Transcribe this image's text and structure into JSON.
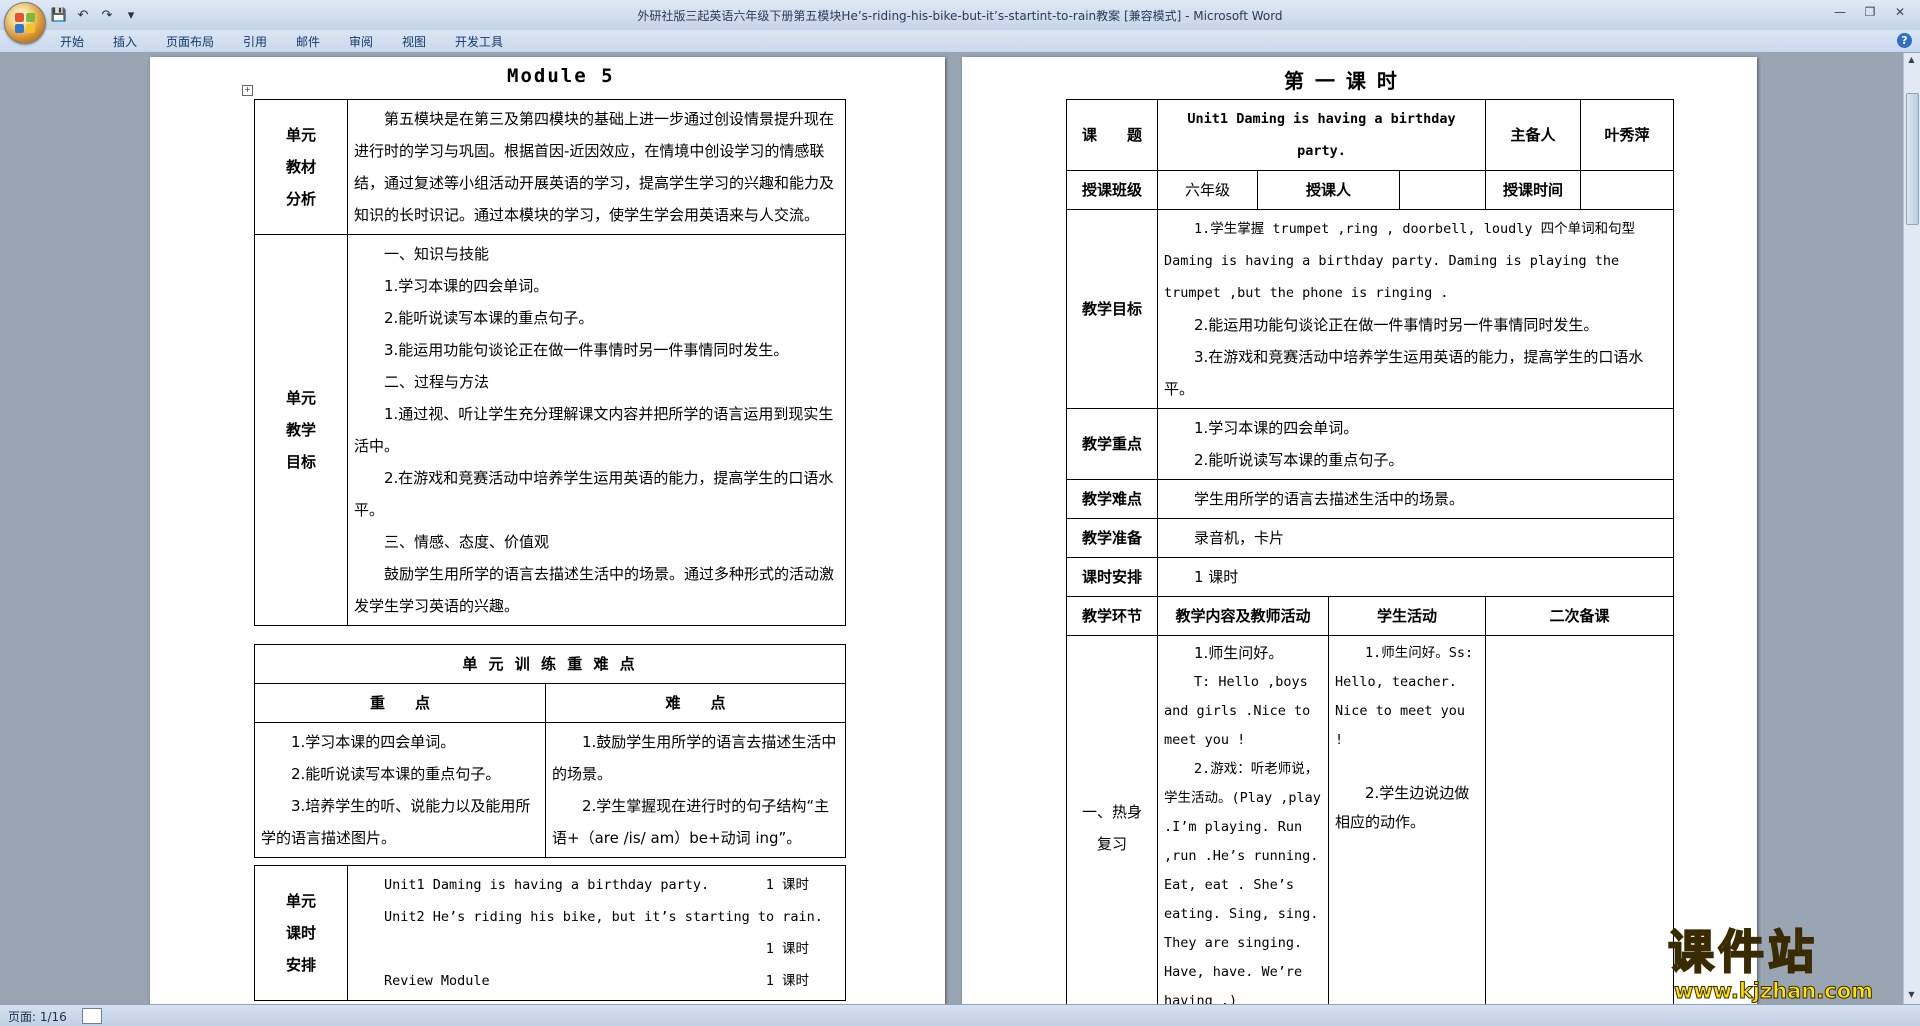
{
  "window": {
    "title": "外研社版三起英语六年级下册第五模块He’s-riding-his-bike-but-it’s-startint-to-rain教案 [兼容模式] - Microsoft Word",
    "controls": [
      "—",
      "❐",
      "✕"
    ]
  },
  "qat": {
    "save": "💾",
    "undo": "↶",
    "redo": "↷",
    "more": "▾"
  },
  "ribbon": {
    "tabs": [
      "开始",
      "插入",
      "页面布局",
      "引用",
      "邮件",
      "审阅",
      "视图",
      "开发工具"
    ],
    "help": "?"
  },
  "status": {
    "page": "页面: 1/16"
  },
  "watermark": {
    "name": "课件站",
    "url": "www.kjzhan.com"
  },
  "left_page": {
    "title": "Module 5",
    "analysis": {
      "label": [
        "单元",
        "教材",
        "分析"
      ],
      "text": "第五模块是在第三及第四模块的基础上进一步通过创设情景提升现在进行时的学习与巩固。根据首因-近因效应，在情境中创设学习的情感联结，通过复述等小组活动开展英语的学习，提高学生学习的兴趣和能力及知识的长时识记。通过本模块的学习，使学生学会用英语来与人交流。"
    },
    "goals": {
      "label": [
        "单元",
        "教学",
        "目标"
      ],
      "lines": [
        "一、知识与技能",
        "1.学习本课的四会单词。",
        "2.能听说读写本课的重点句子。",
        "3.能运用功能句谈论正在做一件事情时另一件事情同时发生。",
        "二、过程与方法",
        "1.通过视、听让学生充分理解课文内容并把所学的语言运用到现实生活中。",
        "2.在游戏和竞赛活动中培养学生运用英语的能力，提高学生的口语水平。",
        "三、情感、态度、价值观",
        "鼓励学生用所学的语言去描述生活中的场景。通过多种形式的活动激发学生学习英语的兴趣。"
      ]
    },
    "key_points": {
      "heading": "单 元 训 练 重 难 点",
      "key_head": "重　　点",
      "diff_head": "难　　点",
      "key_items": [
        "1.学习本课的四会单词。",
        "2.能听说读写本课的重点句子。",
        "3.培养学生的听、说能力以及能用所学的语言描述图片。"
      ],
      "diff_items": [
        "1.鼓励学生用所学的语言去描述生活中的场景。",
        "2.学生掌握现在进行时的句子结构“主语+（are /is/ am）be+动词 ing”。"
      ]
    },
    "schedule": {
      "label": [
        "单元",
        "课时",
        "安排"
      ],
      "rows": [
        {
          "unit": "Unit1 Daming is having a birthday party.",
          "time": "1 课时"
        },
        {
          "unit": "Unit2 He’s riding his bike, but it’s starting to rain.",
          "time": "1 课时"
        },
        {
          "unit": "Review  Module",
          "time": "1 课时"
        }
      ]
    }
  },
  "right_page": {
    "title": "第 一 课 时",
    "topic_label": "课　　题",
    "topic": "Unit1 Daming is having a birthday party.",
    "prep_label": "主备人",
    "prep_name": "叶秀萍",
    "class_label": "授课班级",
    "class_value": "六年级",
    "teacher_label": "授课人",
    "teacher_value": "",
    "time_label": "授课时间",
    "time_value": "",
    "objectives_label": "教学目标",
    "objectives": [
      "1.学生掌握 trumpet ,ring , doorbell,  loudly 四个单词和句型 Daming is having a birthday party.   Daming is playing the trumpet ,but the phone is ringing .",
      "2.能运用功能句谈论正在做一件事情时另一件事情同时发生。",
      "3.在游戏和竞赛活动中培养学生运用英语的能力，提高学生的口语水平。"
    ],
    "key_label": "教学重点",
    "key": [
      "1.学习本课的四会单词。",
      "2.能听说读写本课的重点句子。"
    ],
    "diff_label": "教学难点",
    "diff": "学生用所学的语言去描述生活中的场景。",
    "prepare_label": "教学准备",
    "prepare": "录音机，卡片",
    "hours_label": "课时安排",
    "hours": "1 课时",
    "step_head": "教学环节",
    "content_head": "教学内容及教师活动",
    "student_head": "学生活动",
    "second_head": "二次备课",
    "step1_label": [
      "一、热身",
      "复习"
    ],
    "content1": [
      "1.师生问好。",
      "T: Hello ,boys and girls .Nice to meet you !",
      "2.游戏：听老师说，学生活动。(Play ,play .I’m playing. Run ,run .He’s running. Eat, eat . She’s eating. Sing, sing.  They are singing.  Have, have. We’re having .)"
    ],
    "student1": [
      "1.师生问好。Ss: Hello, teacher. Nice to meet you !",
      "2.学生边说边做相应的动作。"
    ]
  }
}
